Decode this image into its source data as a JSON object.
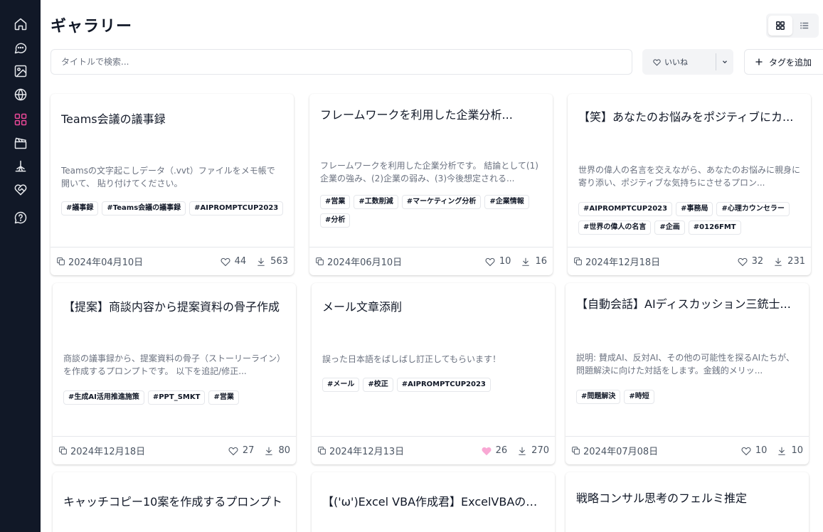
{
  "sidebar": {
    "items": [
      {
        "name": "home-icon",
        "active": false
      },
      {
        "name": "chat-icon",
        "active": false
      },
      {
        "name": "image-icon",
        "active": false
      },
      {
        "name": "globe-icon",
        "active": false
      },
      {
        "name": "gallery-grid-icon",
        "active": true
      },
      {
        "name": "clapperboard-icon",
        "active": false
      },
      {
        "name": "sparkle-icon",
        "active": false
      },
      {
        "name": "heart-handshake-icon",
        "active": false
      },
      {
        "name": "help-icon",
        "active": false
      }
    ]
  },
  "colors": {
    "sidebar_bg": "#111827",
    "accent": "#ec4899",
    "liked": "#f9a8d4"
  },
  "header": {
    "title": "ギャラリー"
  },
  "search": {
    "placeholder": "タイトルで検索..."
  },
  "filter": {
    "like_label": "いいね"
  },
  "add_tag": {
    "label": "タグを追加"
  },
  "cards": [
    {
      "title": "Teams会議の議事録",
      "desc": "Teamsの文字起こしデータ（.vvt）ファイルをメモ帳で開いて、 貼り付けてください。",
      "tags": [
        "#議事録",
        "#Teams会議の議事録",
        "#AIPROMPTCUP2023"
      ],
      "date": "2024年04月10日",
      "likes": "44",
      "downloads": "563"
    },
    {
      "title": "フレームワークを利用した企業分析...",
      "desc": "フレームワークを利用した企業分析です。 結論として(1)企業の強み、(2)企業の弱み、(3)今後想定される...",
      "tags": [
        "#営業",
        "#工数削減",
        "#マーケティング分析",
        "#企業情報",
        "#分析"
      ],
      "date": "2024年06月10日",
      "likes": "10",
      "downloads": "16"
    },
    {
      "title": "【笑】あなたのお悩みをポジティブにカ...",
      "desc": "世界の偉人の名言を交えながら、あなたのお悩みに親身に寄り添い、ポジティブな気持ちにさせるプロン...",
      "tags": [
        "#AIPROMPTCUP2023",
        "#事務局",
        "#心理カウンセラー",
        "#世界の偉人の名言",
        "#企画",
        "#0126FMT"
      ],
      "date": "2024年12月18日",
      "likes": "32",
      "downloads": "231"
    },
    {
      "title": "【提案】商談内容から提案資料の骨子作成",
      "desc": "商談の議事録から、提案資料の骨子（ストーリーライン）を作成するプロンプトです。 以下を追記/修正...",
      "tags": [
        "#生成AI活用推進施策",
        "#PPT_SMKT",
        "#営業"
      ],
      "date": "2024年12月18日",
      "likes": "27",
      "downloads": "80"
    },
    {
      "title": "メール文章添削",
      "desc": "誤った日本語をばしばし訂正してもらいます！",
      "tags": [
        "#メール",
        "#校正",
        "#AIPROMPTCUP2023"
      ],
      "date": "2024年12月13日",
      "likes": "26",
      "downloads": "270",
      "liked": true
    },
    {
      "title": "【自動会話】AIディスカッション三銃士...",
      "desc": "説明: 賛成AI、反対AI、その他の可能性を探るAIたちが、問題解決に向けた対話をします。金銭的メリッ...",
      "tags": [
        "#問題解決",
        "#時短"
      ],
      "date": "2024年07月08日",
      "likes": "10",
      "downloads": "10"
    },
    {
      "title": "キャッチコピー10案を作成するプロンプト"
    },
    {
      "title": "【('ω')Excel VBA作成君】ExcelVBAのコ..."
    },
    {
      "title": "戦略コンサル思考のフェルミ推定"
    }
  ]
}
